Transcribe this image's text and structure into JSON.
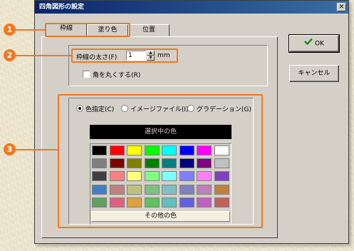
{
  "dialog": {
    "title": "四角図形の設定",
    "close_glyph": "✕"
  },
  "tabs": [
    {
      "label": "枠線",
      "active": true
    },
    {
      "label": "塗り色",
      "active": false
    },
    {
      "label": "位置",
      "active": false
    }
  ],
  "callouts": [
    "1",
    "2",
    "3"
  ],
  "border": {
    "width_label": "枠線の太さ(F)",
    "width_value": "1",
    "unit": "mm",
    "round_corners_label": "角を丸くする(R)",
    "round_corners_checked": false
  },
  "fill": {
    "options": [
      {
        "label": "色指定(C)",
        "selected": true
      },
      {
        "label": "イメージファイル(I)",
        "selected": false
      },
      {
        "label": "グラデーション(G)",
        "selected": false
      }
    ],
    "selected_color_label": "選択中の色",
    "selected_color": "#000000",
    "palette": [
      [
        "#000000",
        "#ff0000",
        "#ffff00",
        "#00ff00",
        "#00ffff",
        "#0000ff",
        "#ff00ff",
        "#ffffff"
      ],
      [
        "#808080",
        "#800000",
        "#808000",
        "#008000",
        "#008080",
        "#000080",
        "#800080",
        "#c0c0c0"
      ],
      [
        "#404040",
        "#ff8080",
        "#ffff80",
        "#80ff80",
        "#80ffff",
        "#8080ff",
        "#ff80ff",
        "#8040c0"
      ],
      [
        "#4080c0",
        "#c08080",
        "#c0c080",
        "#80c080",
        "#80c0c0",
        "#8080c0",
        "#c080c0",
        "#c08040"
      ],
      [
        "#60a060",
        "#e06080",
        "#e0a040",
        "#60c060",
        "#60c0c0",
        "#6060e0",
        "#c060c0",
        "#c06060"
      ]
    ],
    "other_colors_label": "その他の色"
  },
  "buttons": {
    "ok_label": "OK",
    "cancel_label": "キャンセル"
  },
  "colors": {
    "accent": "#f07820",
    "titlebar": "#0a246a",
    "dialog_bg": "#d4d0c8"
  }
}
